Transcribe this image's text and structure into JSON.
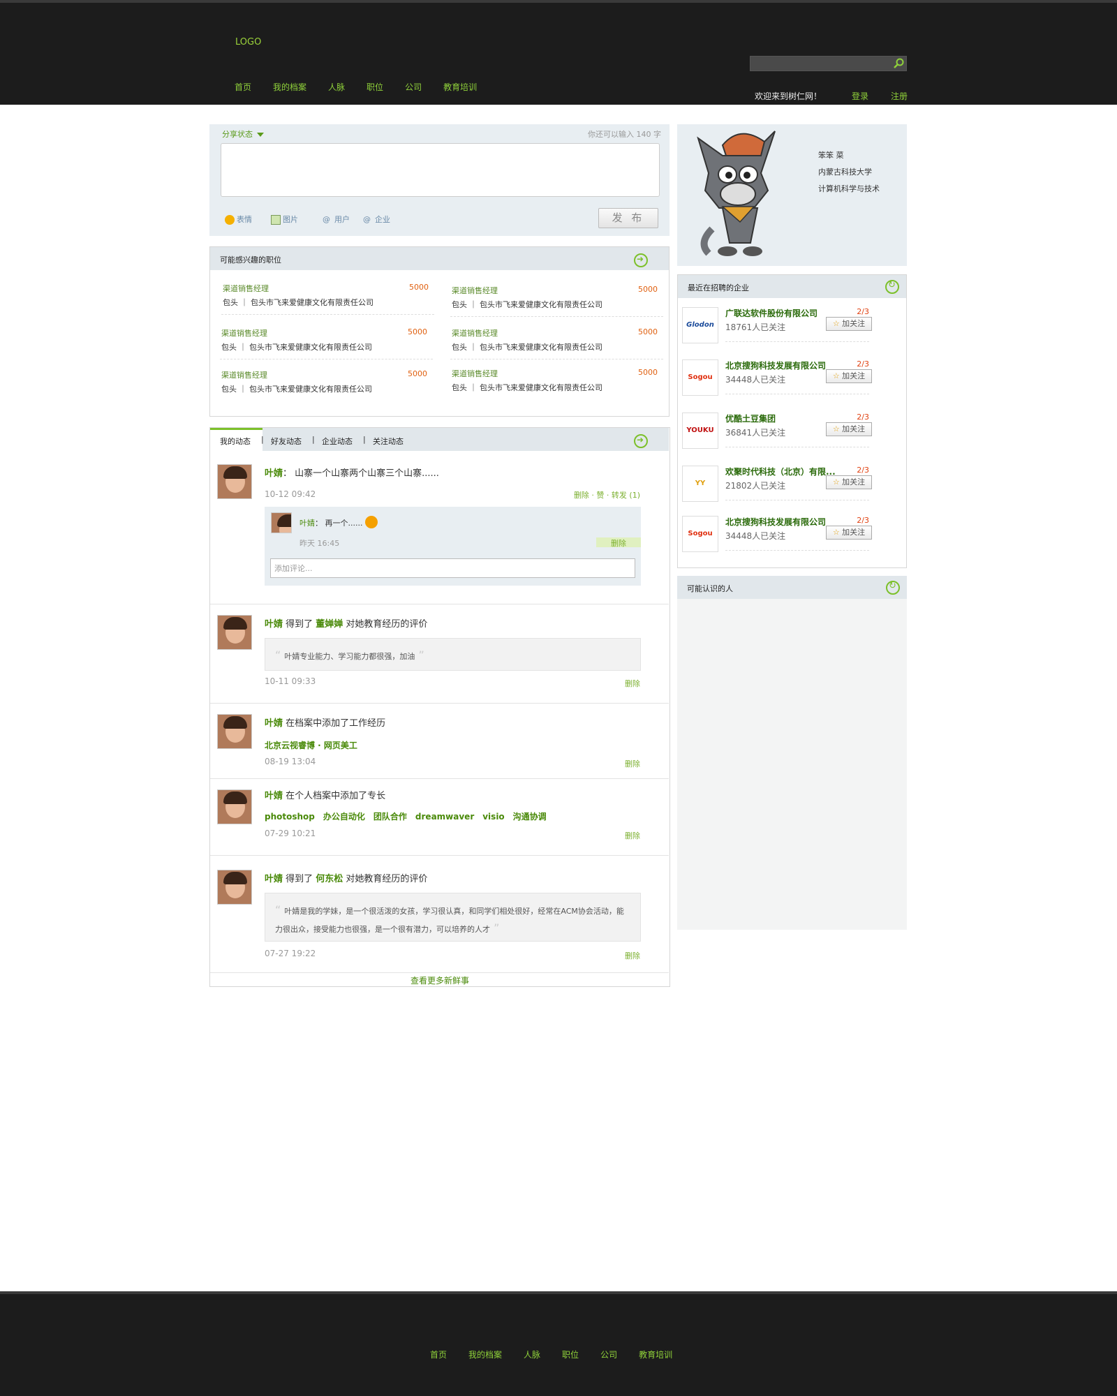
{
  "header": {
    "logo": "LOGO",
    "nav": [
      "首页",
      "我的档案",
      "人脉",
      "职位",
      "公司",
      "教育培训"
    ],
    "welcome": "欢迎来到树仁网！",
    "login": "登录",
    "register": "注册"
  },
  "share": {
    "title": "分享状态",
    "counter": "你还可以输入 140 字",
    "tools": [
      "表情",
      "图片",
      "用户",
      "企业"
    ],
    "post_button": "发 布"
  },
  "jobs": {
    "title": "可能感兴趣的职位",
    "items": [
      {
        "title": "渠道销售经理",
        "salary": "5000",
        "company": "包头 ｜ 包头市飞来爱健康文化有限责任公司"
      },
      {
        "title": "渠道销售经理",
        "salary": "5000",
        "company": "包头 ｜ 包头市飞来爱健康文化有限责任公司"
      },
      {
        "title": "渠道销售经理",
        "salary": "5000",
        "company": "包头 ｜ 包头市飞来爱健康文化有限责任公司"
      },
      {
        "title": "渠道销售经理",
        "salary": "5000",
        "company": "包头 ｜ 包头市飞来爱健康文化有限责任公司"
      },
      {
        "title": "渠道销售经理",
        "salary": "5000",
        "company": "包头 ｜ 包头市飞来爱健康文化有限责任公司"
      },
      {
        "title": "渠道销售经理",
        "salary": "5000",
        "company": "包头 ｜ 包头市飞来爱健康文化有限责任公司"
      }
    ]
  },
  "feed": {
    "tabs": [
      "我的动态",
      "好友动态",
      "企业动态",
      "关注动态"
    ],
    "items": [
      {
        "name": "叶婧",
        "text": "： 山寨一个山寨两个山寨三个山寨......",
        "time": "10-12 09:42",
        "actions": "删除 · 赞 · 转发 (1)"
      },
      {
        "name": "叶婧",
        "text": " 得到了 ",
        "target": "董婵婵",
        "text2": " 对她教育经历的评价",
        "quote": "叶婧专业能力、学习能力都很强，加油",
        "time": "10-11 09:33",
        "delete": "删除"
      },
      {
        "name": "叶婧",
        "text": " 在档案中添加了工作经历",
        "detail": "北京云视睿博 · 网页美工",
        "time": "08-19 13:04",
        "delete": "删除"
      },
      {
        "name": "叶婧",
        "text": " 在个人档案中添加了专长",
        "tags": [
          "photoshop",
          "办公自动化",
          "团队合作",
          "dreamwaver",
          "visio",
          "沟通协调"
        ],
        "time": "07-29 10:21",
        "delete": "删除"
      },
      {
        "name": "叶婧",
        "text": " 得到了 ",
        "target": "何东松",
        "text2": " 对她教育经历的评价",
        "quote": "叶婧是我的学妹，是一个很活泼的女孩，学习很认真，和同学们相处很好，经常在ACM协会活动，能力很出众，接受能力也很强，是一个很有潜力，可以培养的人才",
        "time": "07-27 19:22",
        "delete": "删除"
      }
    ],
    "reply": {
      "name": "叶婧",
      "text": "： 再一个......",
      "time": "昨天 16:45",
      "delete": "删除"
    },
    "comment_placeholder": "添加评论...",
    "more": "查看更多新鲜事"
  },
  "profile": {
    "name": "笨笨 菜",
    "school": "内蒙古科技大学",
    "major": "计算机科学与技术"
  },
  "companies": {
    "title": "最近在招聘的企业",
    "follow_label": "加关注",
    "items": [
      {
        "logo": "Glodon",
        "name": "广联达软件股份有限公司",
        "followers": "18761人已关注",
        "ratio": "2/3",
        "color": "#1a4a9a"
      },
      {
        "logo": "Sogou",
        "name": "北京搜狗科技发展有限公司",
        "followers": "34448人已关注",
        "ratio": "2/3",
        "color": "#e03010"
      },
      {
        "logo": "YOUKU",
        "name": "优酷土豆集团",
        "followers": "36841人已关注",
        "ratio": "2/3",
        "color": "#c01010"
      },
      {
        "logo": "YY",
        "name": "欢聚时代科技（北京）有限...",
        "followers": "21802人已关注",
        "ratio": "2/3",
        "color": "#e0a010"
      },
      {
        "logo": "Sogou",
        "name": "北京搜狗科技发展有限公司",
        "followers": "34448人已关注",
        "ratio": "2/3",
        "color": "#e03010"
      }
    ]
  },
  "people": {
    "title": "可能认识的人"
  },
  "footer": {
    "nav": [
      "首页",
      "我的档案",
      "人脉",
      "职位",
      "公司",
      "教育培训"
    ]
  },
  "colors": {
    "accent": "#7cc02a",
    "header_bg": "#1c1c1c",
    "salary": "#e06010"
  }
}
